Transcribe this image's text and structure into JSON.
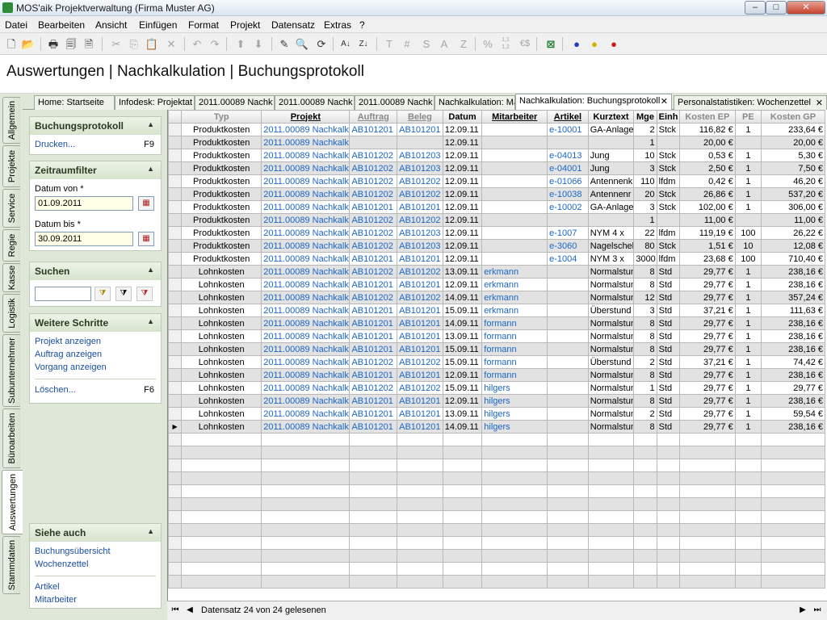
{
  "window": {
    "title": "MOS'aik Projektverwaltung (Firma Muster AG)",
    "minimize": "–",
    "maximize": "□",
    "close": "✕"
  },
  "menu": [
    "Datei",
    "Bearbeiten",
    "Ansicht",
    "Einfügen",
    "Format",
    "Projekt",
    "Datensatz",
    "Extras",
    "?"
  ],
  "toolbar": {
    "icons": [
      "new-document-icon",
      "open-folder-icon",
      "print-icon",
      "print-preview-icon",
      "print-setup-icon",
      "cut-icon",
      "copy-icon",
      "paste-icon",
      "delete-icon",
      "undo-icon",
      "redo-icon",
      "move-up-icon",
      "move-down-icon",
      "edit-pencil-icon",
      "find-icon",
      "refresh-icon",
      "sort-ascending-icon",
      "sort-descending-icon"
    ],
    "glyphs": [
      "🗋",
      "📂",
      "🖶",
      "🗐",
      "🗎",
      "✂",
      "⎘",
      "📋",
      "✕",
      "↶",
      "↷",
      "⬆",
      "⬇",
      "✎",
      "🔍",
      "⟳",
      "A↓",
      "Z↓"
    ],
    "text_buttons": [
      "T",
      "#",
      "S",
      "A",
      "Z",
      "%",
      "1,1\n1,2",
      "€$"
    ],
    "user_icons": [
      "excel-export-icon",
      "user-blue-icon",
      "user-yellow-icon",
      "user-red-icon"
    ]
  },
  "page_title": "Auswertungen | Nachkalkulation | Buchungsprotokoll",
  "vertical_tabs": [
    "Allgemein",
    "Projekte",
    "Service",
    "Regie",
    "Kasse",
    "Logistik",
    "Subunternehmer",
    "Büroarbeiten",
    "Auswertungen",
    "Stammdaten"
  ],
  "doc_tabs": [
    "Home: Startseite",
    "Infodesk: Projektat",
    "2011.00089 Nachk",
    "2011.00089 Nachk",
    "2011.00089 Nachk",
    "Nachkalkulation: Ma",
    "Nachkalkulation: Buchungsprotokoll",
    "Personalstatistiken: Wochenzettel"
  ],
  "side": {
    "buchungsprotokoll": {
      "title": "Buchungsprotokoll",
      "print": "Drucken...",
      "print_key": "F9"
    },
    "zeitraum": {
      "title": "Zeitraumfilter",
      "from_label": "Datum von *",
      "from_value": "01.09.2011",
      "to_label": "Datum bis *",
      "to_value": "30.09.2011"
    },
    "suchen": {
      "title": "Suchen"
    },
    "weitere": {
      "title": "Weitere Schritte",
      "links": [
        "Projekt anzeigen",
        "Auftrag anzeigen",
        "Vorgang anzeigen"
      ],
      "delete": "Löschen...",
      "delete_key": "F6"
    },
    "siehe": {
      "title": "Siehe auch",
      "links": [
        "Buchungsübersicht",
        "Wochenzettel",
        "Artikel",
        "Mitarbeiter"
      ]
    }
  },
  "table": {
    "columns": [
      "Typ",
      "Projekt",
      "Auftrag",
      "Beleg",
      "Datum",
      "Mitarbeiter",
      "Artikel",
      "Kurztext",
      "Mge",
      "Einh",
      "Kosten EP",
      "PE",
      "Kosten GP"
    ],
    "rows": [
      [
        "Produktkosten",
        "2011.00089 Nachkalk",
        "AB101201",
        "AB101201",
        "12.09.11",
        "",
        "e-10001",
        "GA-Anlage",
        "2",
        "Stck",
        "116,82 €",
        "1",
        "233,64 €"
      ],
      [
        "Produktkosten",
        "2011.00089 Nachkalk",
        "",
        "",
        "12.09.11",
        "",
        "",
        "",
        "1",
        "",
        "20,00 €",
        "",
        "20,00 €"
      ],
      [
        "Produktkosten",
        "2011.00089 Nachkalk",
        "AB101202",
        "AB101203",
        "12.09.11",
        "",
        "e-04013",
        "Jung",
        "10",
        "Stck",
        "0,53 €",
        "1",
        "5,30 €"
      ],
      [
        "Produktkosten",
        "2011.00089 Nachkalk",
        "AB101202",
        "AB101203",
        "12.09.11",
        "",
        "e-04001",
        "Jung",
        "3",
        "Stck",
        "2,50 €",
        "1",
        "7,50 €"
      ],
      [
        "Produktkosten",
        "2011.00089 Nachkalk",
        "AB101202",
        "AB101202",
        "12.09.11",
        "",
        "e-01066",
        "Antennenk",
        "110",
        "lfdm",
        "0,42 €",
        "1",
        "46,20 €"
      ],
      [
        "Produktkosten",
        "2011.00089 Nachkalk",
        "AB101202",
        "AB101202",
        "12.09.11",
        "",
        "e-10038",
        "Antennenr",
        "20",
        "Stck",
        "26,86 €",
        "1",
        "537,20 €"
      ],
      [
        "Produktkosten",
        "2011.00089 Nachkalk",
        "AB101201",
        "AB101201",
        "12.09.11",
        "",
        "e-10002",
        "GA-Anlage",
        "3",
        "Stck",
        "102,00 €",
        "1",
        "306,00 €"
      ],
      [
        "Produktkosten",
        "2011.00089 Nachkalk",
        "AB101202",
        "AB101202",
        "12.09.11",
        "",
        "",
        "",
        "1",
        "",
        "11,00 €",
        "",
        "11,00 €"
      ],
      [
        "Produktkosten",
        "2011.00089 Nachkalk",
        "AB101202",
        "AB101203",
        "12.09.11",
        "",
        "e-1007",
        "NYM 4 x",
        "22",
        "lfdm",
        "119,19 €",
        "100",
        "26,22 €"
      ],
      [
        "Produktkosten",
        "2011.00089 Nachkalk",
        "AB101202",
        "AB101203",
        "12.09.11",
        "",
        "e-3060",
        "Nagelschel",
        "80",
        "Stck",
        "1,51 €",
        "10",
        "12,08 €"
      ],
      [
        "Produktkosten",
        "2011.00089 Nachkalk",
        "AB101201",
        "AB101201",
        "12.09.11",
        "",
        "e-1004",
        "NYM 3 x",
        "3000",
        "lfdm",
        "23,68 €",
        "100",
        "710,40 €"
      ],
      [
        "Lohnkosten",
        "2011.00089 Nachkalk",
        "AB101202",
        "AB101202",
        "13.09.11",
        "erkmann",
        "",
        "Normalstun",
        "8",
        "Std",
        "29,77 €",
        "1",
        "238,16 €"
      ],
      [
        "Lohnkosten",
        "2011.00089 Nachkalk",
        "AB101201",
        "AB101201",
        "12.09.11",
        "erkmann",
        "",
        "Normalstun",
        "8",
        "Std",
        "29,77 €",
        "1",
        "238,16 €"
      ],
      [
        "Lohnkosten",
        "2011.00089 Nachkalk",
        "AB101202",
        "AB101202",
        "14.09.11",
        "erkmann",
        "",
        "Normalstun",
        "12",
        "Std",
        "29,77 €",
        "1",
        "357,24 €"
      ],
      [
        "Lohnkosten",
        "2011.00089 Nachkalk",
        "AB101201",
        "AB101201",
        "15.09.11",
        "erkmann",
        "",
        "Überstund",
        "3",
        "Std",
        "37,21 €",
        "1",
        "111,63 €"
      ],
      [
        "Lohnkosten",
        "2011.00089 Nachkalk",
        "AB101201",
        "AB101201",
        "14.09.11",
        "formann",
        "",
        "Normalstun",
        "8",
        "Std",
        "29,77 €",
        "1",
        "238,16 €"
      ],
      [
        "Lohnkosten",
        "2011.00089 Nachkalk",
        "AB101201",
        "AB101201",
        "13.09.11",
        "formann",
        "",
        "Normalstun",
        "8",
        "Std",
        "29,77 €",
        "1",
        "238,16 €"
      ],
      [
        "Lohnkosten",
        "2011.00089 Nachkalk",
        "AB101201",
        "AB101201",
        "15.09.11",
        "formann",
        "",
        "Normalstun",
        "8",
        "Std",
        "29,77 €",
        "1",
        "238,16 €"
      ],
      [
        "Lohnkosten",
        "2011.00089 Nachkalk",
        "AB101202",
        "AB101202",
        "15.09.11",
        "formann",
        "",
        "Überstund",
        "2",
        "Std",
        "37,21 €",
        "1",
        "74,42 €"
      ],
      [
        "Lohnkosten",
        "2011.00089 Nachkalk",
        "AB101201",
        "AB101201",
        "12.09.11",
        "formann",
        "",
        "Normalstun",
        "8",
        "Std",
        "29,77 €",
        "1",
        "238,16 €"
      ],
      [
        "Lohnkosten",
        "2011.00089 Nachkalk",
        "AB101202",
        "AB101202",
        "15.09.11",
        "hilgers",
        "",
        "Normalstun",
        "1",
        "Std",
        "29,77 €",
        "1",
        "29,77 €"
      ],
      [
        "Lohnkosten",
        "2011.00089 Nachkalk",
        "AB101201",
        "AB101201",
        "12.09.11",
        "hilgers",
        "",
        "Normalstun",
        "8",
        "Std",
        "29,77 €",
        "1",
        "238,16 €"
      ],
      [
        "Lohnkosten",
        "2011.00089 Nachkalk",
        "AB101201",
        "AB101201",
        "13.09.11",
        "hilgers",
        "",
        "Normalstun",
        "2",
        "Std",
        "29,77 €",
        "1",
        "59,54 €"
      ],
      [
        "Lohnkosten",
        "2011.00089 Nachkalk",
        "AB101201",
        "AB101201",
        "14.09.11",
        "hilgers",
        "",
        "Normalstun",
        "8",
        "Std",
        "29,77 €",
        "1",
        "238,16 €"
      ]
    ],
    "current_row_indicator": "▶"
  },
  "nav": {
    "status": "Datensatz 24 von 24 gelesenen",
    "first": "⏮",
    "prev": "◀",
    "next": "▶",
    "last": "⏭"
  }
}
